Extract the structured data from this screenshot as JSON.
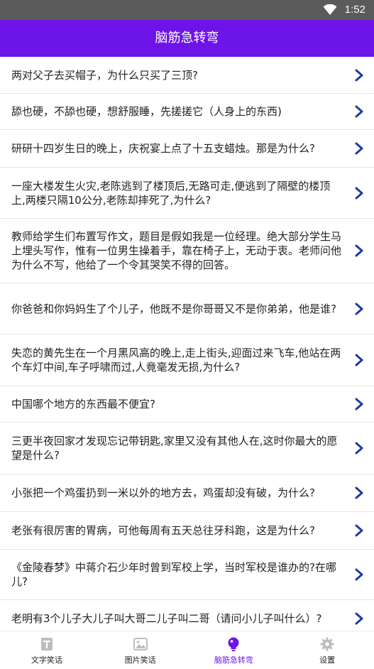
{
  "status_bar": {
    "time": "1:52",
    "wifi_icon": "wifi-icon"
  },
  "app_bar": {
    "title": "脑筋急转弯"
  },
  "colors": {
    "primary": "#6d14e8",
    "chevron": "#1f3aa3",
    "tab_inactive": "#bdbdbd"
  },
  "questions": [
    "两对父子去买帽子，为什么只买了三顶?",
    "舔也硬，不舔也硬，想舒服睡，先搓搓它（人身上的东西)",
    "研研十四岁生日的晚上，庆祝宴上点了十五支蜡烛。那是为什么?",
    "一座大楼发生火灾,老陈逃到了楼顶后,无路可走,便逃到了隔壁的楼顶上,两楼只隔10公分,老陈却摔死了,为什么?",
    "教师给学生们布置写作文，题目是假如我是一位经理。绝大部分学生马上埋头写作，惟有一位男生操着手，靠在椅子上，无动于衷。老师问他为什么不写，他给了一个令其哭笑不得的回答。",
    "你爸爸和你妈妈生了个儿子，他既不是你哥哥又不是你弟弟，他是谁?",
    "失恋的黄先生在一个月黑风高的晚上,走上街头,迎面过来飞车,他站在两个车灯中间,车子呼啸而过,人竟毫发无损,为什么?",
    "中国哪个地方的东西最不便宜?",
    "三更半夜回家才发现忘记带钥匙,家里又没有其他人在,这时你最大的愿望是什么?",
    "小张把一个鸡蛋扔到一米以外的地方去，鸡蛋却没有破，为什么?",
    "老张有很厉害的胃病，可他每周有五天总往牙科跑，这是为什么?",
    "《金陵春梦》中蒋介石少年时曾到军校上学，当时军校是谁办的?在哪儿?",
    "老明有3个儿子大儿子叫大哥二儿子叫二哥（请问小儿子叫什么）?"
  ],
  "tabs": [
    {
      "label": "文字笑话",
      "icon": "text-document-icon",
      "active": false
    },
    {
      "label": "图片笑话",
      "icon": "image-icon",
      "active": false
    },
    {
      "label": "脑筋急转弯",
      "icon": "lightbulb-icon",
      "active": true
    },
    {
      "label": "设置",
      "icon": "gear-icon",
      "active": false
    }
  ]
}
